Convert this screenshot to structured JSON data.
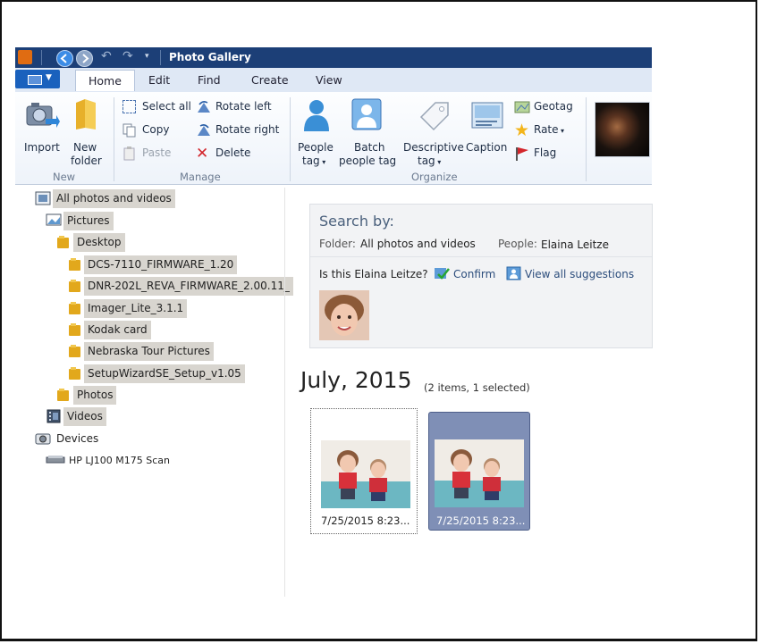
{
  "window": {
    "title": "Photo Gallery"
  },
  "tabs": [
    "Home",
    "Edit",
    "Find",
    "Create",
    "View"
  ],
  "ribbon": {
    "new_group": {
      "label": "New",
      "import": "Import",
      "new_folder": [
        "New",
        "folder"
      ]
    },
    "manage_group": {
      "label": "Manage",
      "select_all": "Select all",
      "copy": "Copy",
      "paste": "Paste",
      "rotate_left": "Rotate left",
      "rotate_right": "Rotate right",
      "delete": "Delete"
    },
    "organize_group": {
      "label": "Organize",
      "people_tag": [
        "People",
        "tag"
      ],
      "batch_people_tag": [
        "Batch",
        "people tag"
      ],
      "descriptive_tag": [
        "Descriptive",
        "tag"
      ],
      "caption": "Caption",
      "geotag": "Geotag",
      "rate": "Rate",
      "flag": "Flag"
    }
  },
  "nav": {
    "all": "All photos and videos",
    "pictures": "Pictures",
    "desktop": "Desktop",
    "subfolders": [
      "DCS-7110_FIRMWARE_1.20",
      "DNR-202L_REVA_FIRMWARE_2.00.11_",
      "Imager_Lite_3.1.1",
      "Kodak card",
      "Nebraska Tour Pictures",
      "SetupWizardSE_Setup_v1.05"
    ],
    "photos": "Photos",
    "videos": "Videos",
    "devices": "Devices",
    "device_item": "HP LJ100 M175 Scan"
  },
  "search": {
    "heading": "Search by:",
    "folder_label": "Folder:",
    "folder_value": "All photos and videos",
    "people_label": "People:",
    "people_value": "Elaina Leitze",
    "question": "Is this Elaina Leitze?",
    "confirm": "Confirm",
    "view_all": "View all suggestions"
  },
  "gallery": {
    "date_heading": "July, 2015",
    "count": "(2 items, 1 selected)",
    "items": [
      {
        "caption": "7/25/2015 8:23...",
        "selected": false
      },
      {
        "caption": "7/25/2015 8:23...",
        "selected": true
      }
    ]
  },
  "colors": {
    "title_bar": "#1c3f77",
    "file_tab": "#1a61bd",
    "selection": "#7f8fb6",
    "nav_highlight": "#d8d5cf"
  }
}
